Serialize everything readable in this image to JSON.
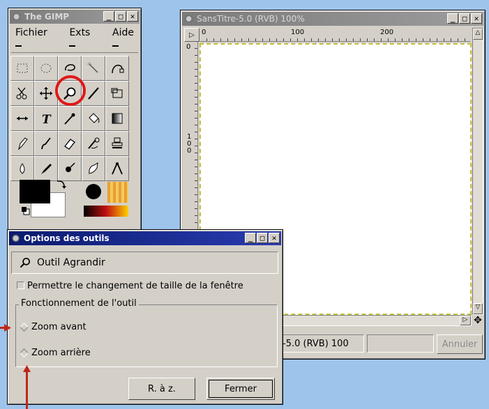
{
  "toolbox": {
    "title": "The GIMP",
    "menu": [
      "Fichier",
      "Exts",
      "Aide"
    ],
    "tools": [
      "rect-select-icon",
      "ellipse-select-icon",
      "lasso-icon",
      "magic-wand-icon",
      "bezier-icon",
      "scissors-icon",
      "move-icon",
      "magnify-icon",
      "crop-icon",
      "transform-icon",
      "flip-icon",
      "text-icon",
      "color-picker-icon",
      "bucket-fill-icon",
      "blend-icon",
      "pencil-icon",
      "paintbrush-icon",
      "eraser-icon",
      "airbrush-icon",
      "clone-icon",
      "convolve-icon",
      "ink-icon",
      "dodge-icon",
      "smudge-icon",
      "measure-icon"
    ],
    "selected_tool": "magnify-icon",
    "fg_color": "#000000",
    "bg_color": "#ffffff"
  },
  "image_window": {
    "title": "SansTitre-5.0 (RVB) 100%",
    "ruler_top": [
      "0",
      "100",
      "200"
    ],
    "ruler_left": [
      "0",
      "100"
    ],
    "status": "-5.0 (RVB) 100",
    "cancel_label": "Annuler"
  },
  "tool_options": {
    "title": "Options des outils",
    "tool_name": "Outil Agrandir",
    "resize_label": "Permettre le changement de taille de la fenêtre",
    "group_label": "Fonctionnement de l'outil",
    "zoom_in": "Zoom avant",
    "zoom_out": "Zoom arrière",
    "reset_label": "R. à z.",
    "close_label": "Fermer"
  },
  "colors": {
    "desktop": "#9ec4eb",
    "annotation": "#c0271a",
    "active_title": "#0a1a6e"
  }
}
